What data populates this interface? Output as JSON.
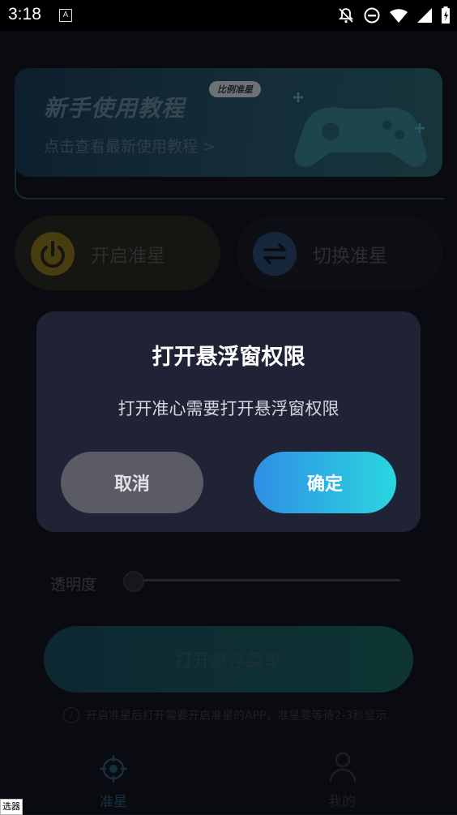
{
  "status_bar": {
    "time": "3:18",
    "notification_icon_letter": "A",
    "icons": [
      "notifications-off-icon",
      "do-not-disturb-icon",
      "wifi-icon",
      "signal-icon",
      "battery-icon"
    ]
  },
  "banner": {
    "title": "新手使用教程",
    "badge": "比例准星",
    "subtitle": "点击查看最新使用教程 >"
  },
  "actions": {
    "open_label": "开启准星",
    "switch_label": "切换准星"
  },
  "dialog": {
    "title": "打开悬浮窗权限",
    "message": "打开准心需要打开悬浮窗权限",
    "cancel_label": "取消",
    "confirm_label": "确定"
  },
  "settings": {
    "opacity_label": "透明度",
    "opacity_value": 0
  },
  "float_menu_button": "打开悬浮菜单",
  "tip": "开启准星后打开需要开启准星的APP，准星要等待2-3秒显示",
  "bottom_nav": {
    "items": [
      {
        "label": "准星",
        "icon": "crosshair-icon",
        "active": true
      },
      {
        "label": "我的",
        "icon": "user-icon",
        "active": false
      }
    ]
  },
  "corner_label": "选器",
  "colors": {
    "background": "#131722",
    "dialog_bg": "#202236",
    "confirm_gradient_start": "#2f8fe4",
    "confirm_gradient_end": "#2ad6e0",
    "cancel_bg": "#5a5b65",
    "active_nav": "#2f5f86"
  }
}
